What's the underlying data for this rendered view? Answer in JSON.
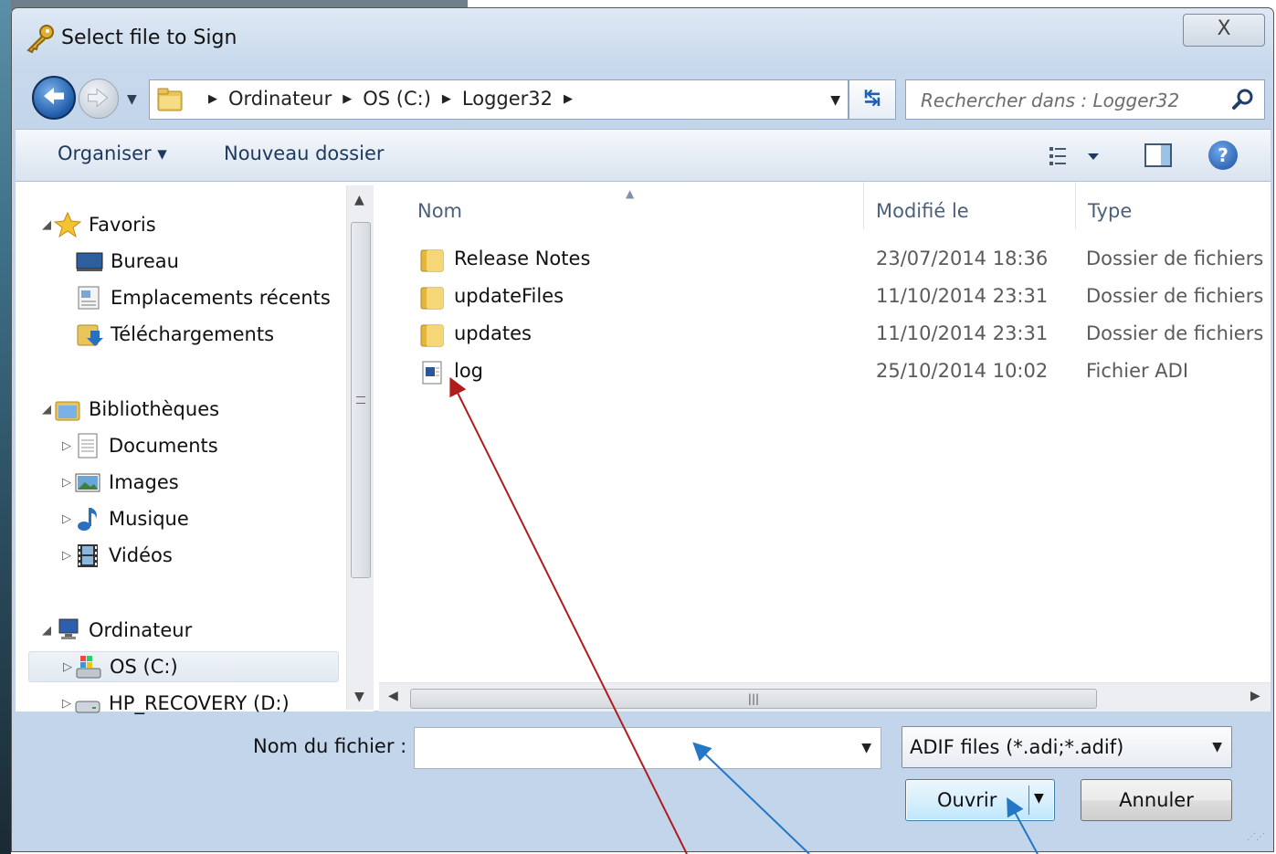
{
  "window": {
    "title": "Select file to Sign",
    "close_label": "X"
  },
  "address": {
    "crumbs": [
      "Ordinateur",
      "OS (C:)",
      "Logger32"
    ],
    "search_placeholder": "Rechercher dans : Logger32"
  },
  "toolbar": {
    "organize_label": "Organiser ▾",
    "new_folder_label": "Nouveau dossier",
    "help_label": "?"
  },
  "nav": {
    "favorites": {
      "label": "Favoris",
      "items": [
        "Bureau",
        "Emplacements récents",
        "Téléchargements"
      ]
    },
    "libraries": {
      "label": "Bibliothèques",
      "items": [
        "Documents",
        "Images",
        "Musique",
        "Vidéos"
      ]
    },
    "computer": {
      "label": "Ordinateur",
      "items": [
        "OS (C:)",
        "HP_RECOVERY (D:)"
      ]
    }
  },
  "files": {
    "columns": [
      "Nom",
      "Modifié le",
      "Type"
    ],
    "rows": [
      {
        "name": "Release Notes",
        "date": "23/07/2014 18:36",
        "type": "Dossier de fichiers",
        "icon": "folder-icon"
      },
      {
        "name": "updateFiles",
        "date": "11/10/2014 23:31",
        "type": "Dossier de fichiers",
        "icon": "folder-icon"
      },
      {
        "name": "updates",
        "date": "11/10/2014 23:31",
        "type": "Dossier de fichiers",
        "icon": "folder-icon"
      },
      {
        "name": "log",
        "date": "25/10/2014 10:02",
        "type": "Fichier ADI",
        "icon": "document-icon"
      }
    ]
  },
  "bottom": {
    "filename_label": "Nom du fichier :",
    "filename_value": "",
    "filter_value": "ADIF files (*.adi;*.adif)",
    "open_label": "Ouvrir",
    "cancel_label": "Annuler"
  },
  "colors": {
    "annotation_red": "#b01c1c",
    "annotation_blue": "#2477c4"
  }
}
